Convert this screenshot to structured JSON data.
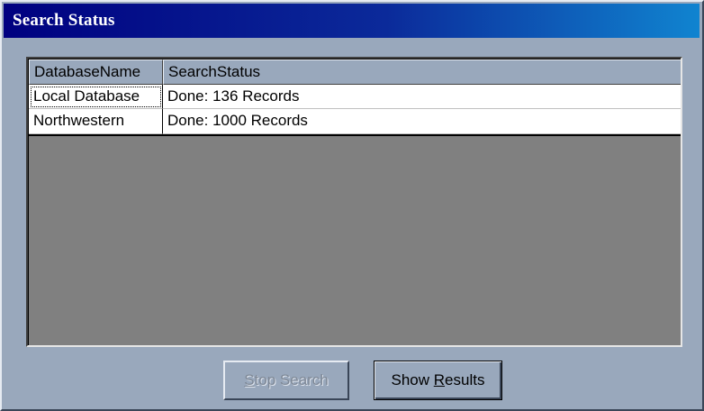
{
  "window": {
    "title": "Search Status"
  },
  "grid": {
    "columns": [
      "DatabaseName",
      "SearchStatus"
    ],
    "rows": [
      {
        "database": "Local Database",
        "status": "Done: 136 Records"
      },
      {
        "database": "Northwestern",
        "status": "Done: 1000 Records"
      }
    ]
  },
  "buttons": {
    "stop": {
      "prefix": "",
      "mnemonic": "S",
      "suffix": "top Search",
      "enabled": false
    },
    "show": {
      "prefix": "Show ",
      "mnemonic": "R",
      "suffix": "esults",
      "enabled": true
    }
  },
  "colors": {
    "titlebar_start": "#000080",
    "titlebar_end": "#1084d0",
    "face": "#99a8bc",
    "grid_empty": "#808080"
  }
}
